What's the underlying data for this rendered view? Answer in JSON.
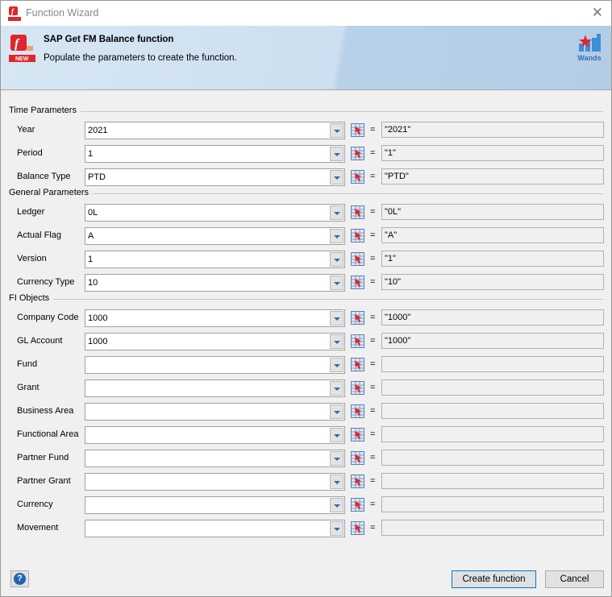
{
  "window": {
    "title": "Function Wizard",
    "close_icon": "close-icon"
  },
  "banner": {
    "title": "SAP Get FM Balance function",
    "subtitle": "Populate the parameters to create the function.",
    "logo_text": "Wands",
    "new_badge": "NEW"
  },
  "sections": [
    {
      "title": "Time Parameters",
      "rows": [
        {
          "label": "Year",
          "value": "2021",
          "result": "\"2021\""
        },
        {
          "label": "Period",
          "value": "1",
          "result": "\"1\""
        },
        {
          "label": "Balance Type",
          "value": "PTD",
          "result": "\"PTD\""
        }
      ]
    },
    {
      "title": "General Parameters",
      "rows": [
        {
          "label": "Ledger",
          "value": "0L",
          "result": "\"0L\""
        },
        {
          "label": "Actual Flag",
          "value": "A",
          "result": "\"A\""
        },
        {
          "label": "Version",
          "value": "1",
          "result": "\"1\""
        },
        {
          "label": "Currency Type",
          "value": "10",
          "result": "\"10\""
        }
      ]
    },
    {
      "title": "FI Objects",
      "rows": [
        {
          "label": "Company Code",
          "value": "1000",
          "result": "\"1000\""
        },
        {
          "label": "GL Account",
          "value": "1000",
          "result": "\"1000\""
        },
        {
          "label": "Fund",
          "value": "",
          "result": ""
        },
        {
          "label": "Grant",
          "value": "",
          "result": ""
        },
        {
          "label": "Business Area",
          "value": "",
          "result": ""
        },
        {
          "label": "Functional Area",
          "value": "",
          "result": ""
        },
        {
          "label": "Partner Fund",
          "value": "",
          "result": ""
        },
        {
          "label": "Partner Grant",
          "value": "",
          "result": ""
        },
        {
          "label": "Currency",
          "value": "",
          "result": ""
        },
        {
          "label": "Movement",
          "value": "",
          "result": ""
        }
      ]
    }
  ],
  "equals": "=",
  "footer": {
    "create_label": "Create function",
    "cancel_label": "Cancel",
    "help": "?"
  }
}
